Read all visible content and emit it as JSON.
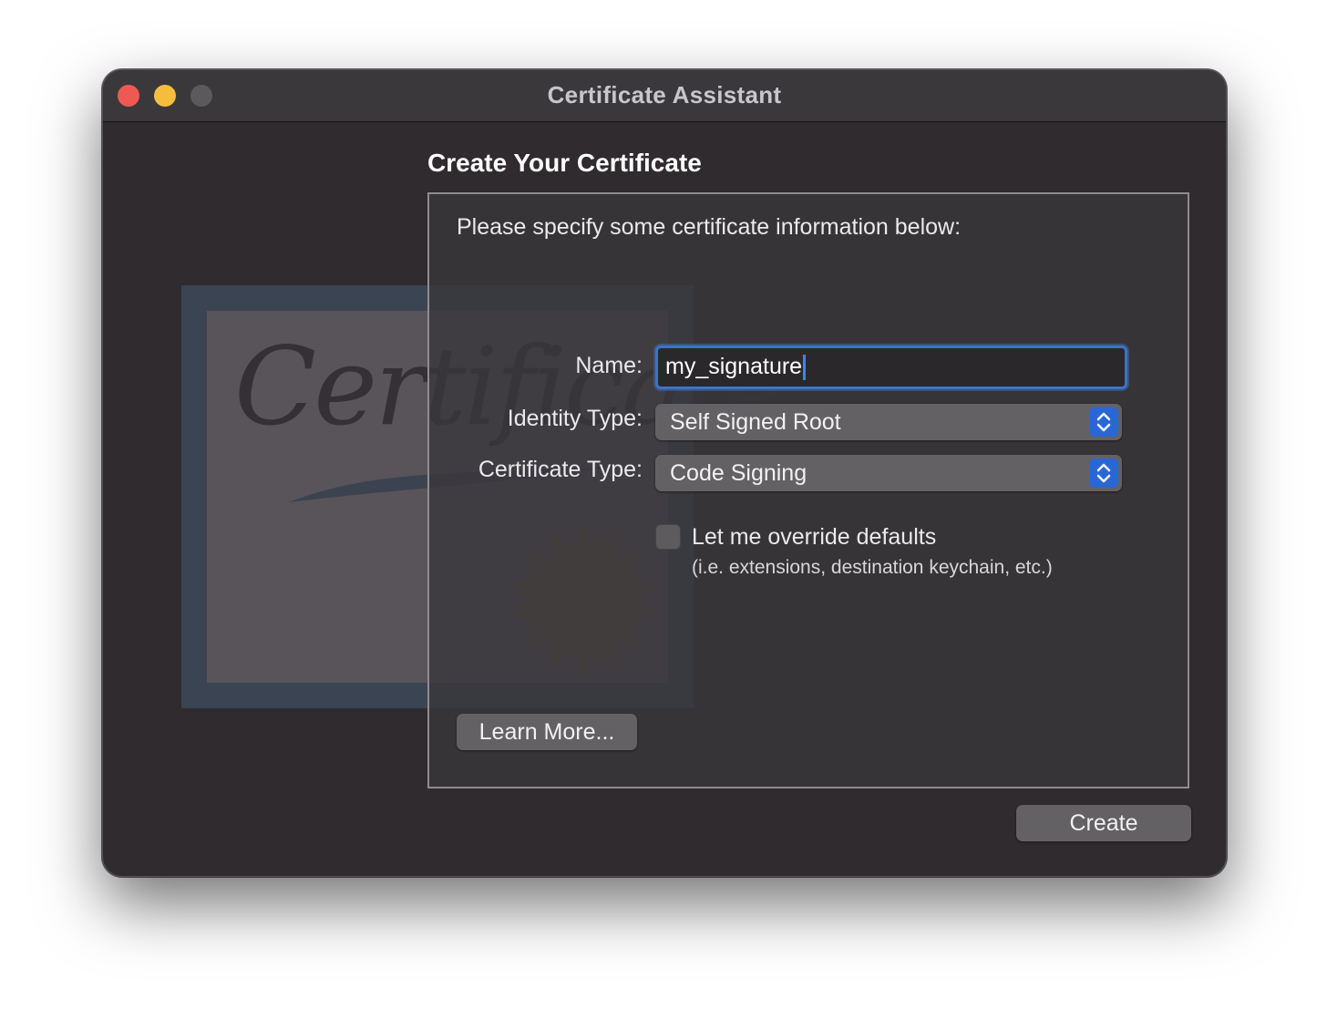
{
  "window": {
    "title": "Certificate Assistant"
  },
  "illustration": {
    "script_text": "Certificate"
  },
  "page": {
    "heading": "Create Your Certificate",
    "intro": "Please specify some certificate information below:"
  },
  "form": {
    "name_label": "Name:",
    "name_value": "my_signature",
    "identity_type_label": "Identity Type:",
    "identity_type_value": "Self Signed Root",
    "certificate_type_label": "Certificate Type:",
    "certificate_type_value": "Code Signing",
    "override_label": "Let me override defaults",
    "override_sub": "(i.e. extensions, destination keychain, etc.)",
    "override_checked": false
  },
  "buttons": {
    "learn_more": "Learn More...",
    "create": "Create"
  },
  "colors": {
    "accent": "#2a67d6",
    "window_bg": "#2f2b2e",
    "close": "#ee5a52",
    "minimize": "#f5bd3e"
  }
}
